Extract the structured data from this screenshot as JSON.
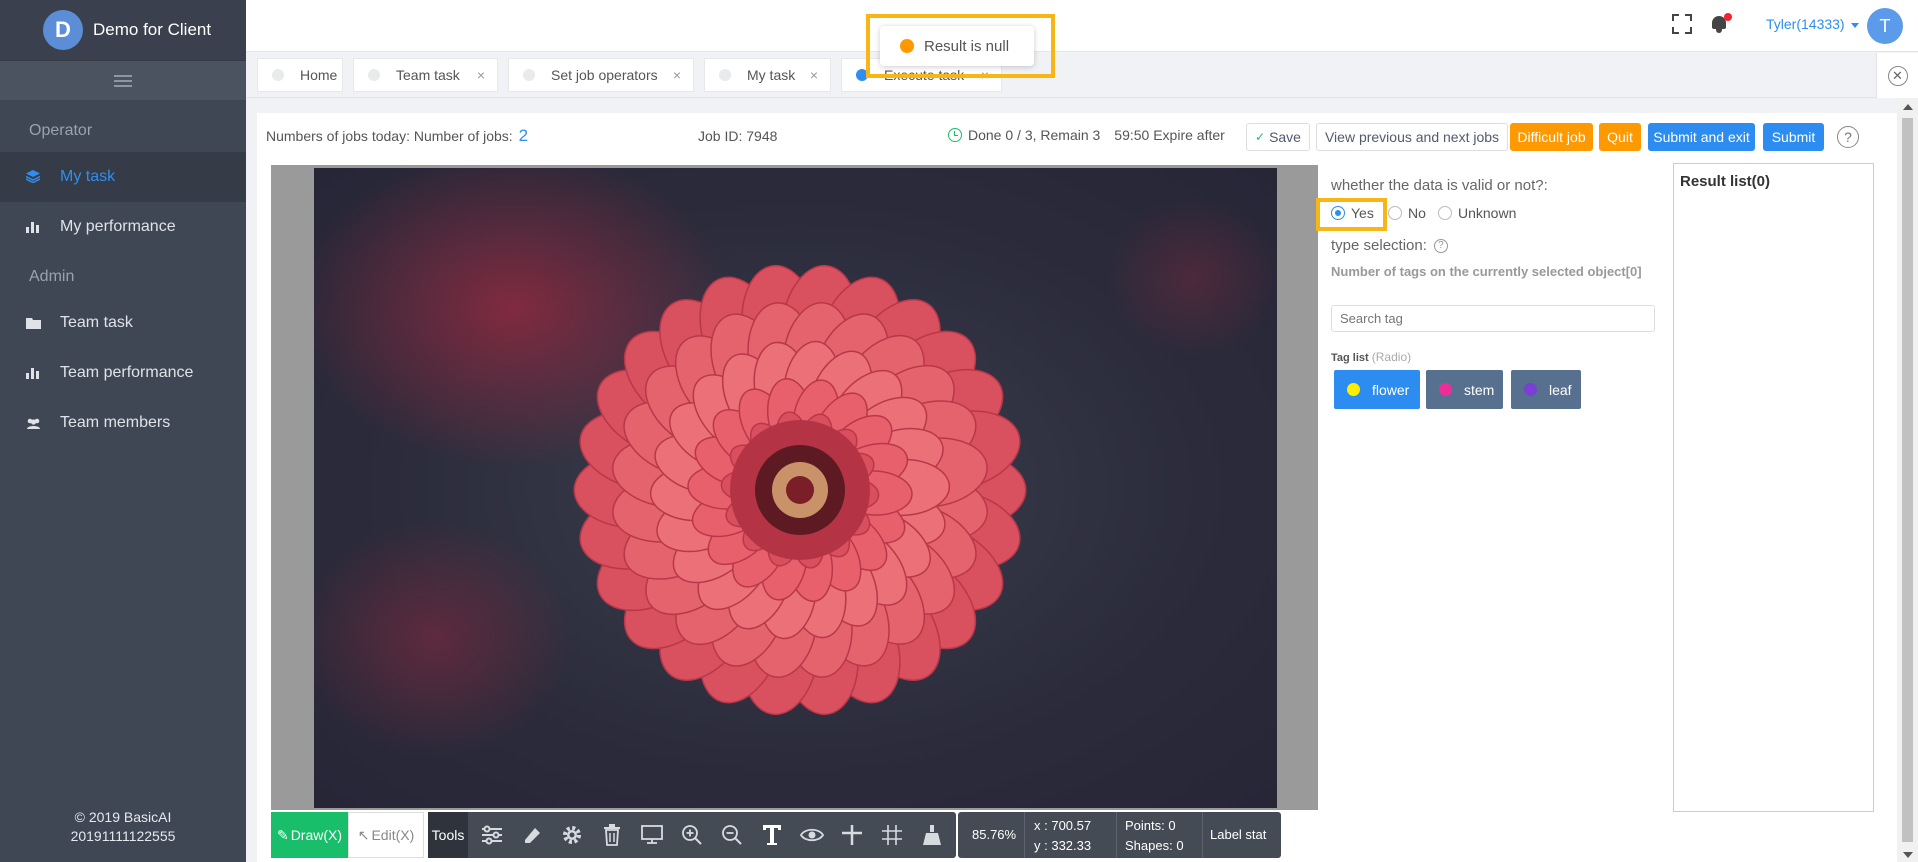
{
  "app": {
    "logo_letter": "D",
    "name": "Demo for Client"
  },
  "sidebar": {
    "sections": [
      {
        "label": "Operator",
        "items": [
          {
            "label": "My task",
            "icon": "layers-icon",
            "active": true
          },
          {
            "label": "My performance",
            "icon": "bar-chart-icon",
            "active": false
          }
        ]
      },
      {
        "label": "Admin",
        "items": [
          {
            "label": "Team task",
            "icon": "folder-icon",
            "active": false
          },
          {
            "label": "Team performance",
            "icon": "bar-chart-icon",
            "active": false
          },
          {
            "label": "Team members",
            "icon": "team-icon",
            "active": false
          }
        ]
      }
    ],
    "footer_line1": "© 2019 BasicAI",
    "footer_line2": "20191111122555"
  },
  "topbar": {
    "username": "Tyler(14333)",
    "avatar_letter": "T"
  },
  "tabs": [
    {
      "label": "Home"
    },
    {
      "label": "Team task",
      "close": "×"
    },
    {
      "label": "Set job operators",
      "close": "×"
    },
    {
      "label": "My task",
      "close": "×"
    },
    {
      "label": "Execute task",
      "close": "×",
      "active": true
    }
  ],
  "toast": {
    "message": "Result is null",
    "type": "warning",
    "color": "#ff9900"
  },
  "job": {
    "jobs_today_label": "Numbers of jobs today: Number of jobs:",
    "jobs_count": "2",
    "job_id": "Job ID: 7948",
    "progress": "Done 0 / 3, Remain 3",
    "expire": "59:50 Expire after"
  },
  "actions": {
    "save": "Save",
    "view_prev_next": "View previous and next jobs",
    "difficult": "Difficult job",
    "quit": "Quit",
    "submit_exit": "Submit and exit",
    "submit": "Submit",
    "help": "?"
  },
  "toolbar": {
    "draw": "Draw(X)",
    "edit": "Edit(X)",
    "tools_label": "Tools",
    "zoom": "85.76%",
    "x": "x : 700.57",
    "y": "y : 332.33",
    "points": "Points:  0",
    "shapes": "Shapes:  0",
    "label_stat": "Label stat"
  },
  "panel": {
    "question": "whether the data is valid or not?:",
    "options": [
      "Yes",
      "No",
      "Unknown"
    ],
    "selected": "Yes",
    "type_selection": "type selection:",
    "tag_count": "Number of tags on the currently selected object[0]",
    "search_placeholder": "Search tag",
    "tag_list_label": "Tag list",
    "tag_list_mode": "(Radio)",
    "tags": [
      {
        "label": "flower",
        "dot_color": "#ffee00",
        "bg": "#2d8cf0"
      },
      {
        "label": "stem",
        "dot_color": "#ec2d9a",
        "bg": "#57708f"
      },
      {
        "label": "leaf",
        "dot_color": "#7a3fd3",
        "bg": "#57708f"
      }
    ]
  },
  "result": {
    "title": "Result list(0)"
  }
}
